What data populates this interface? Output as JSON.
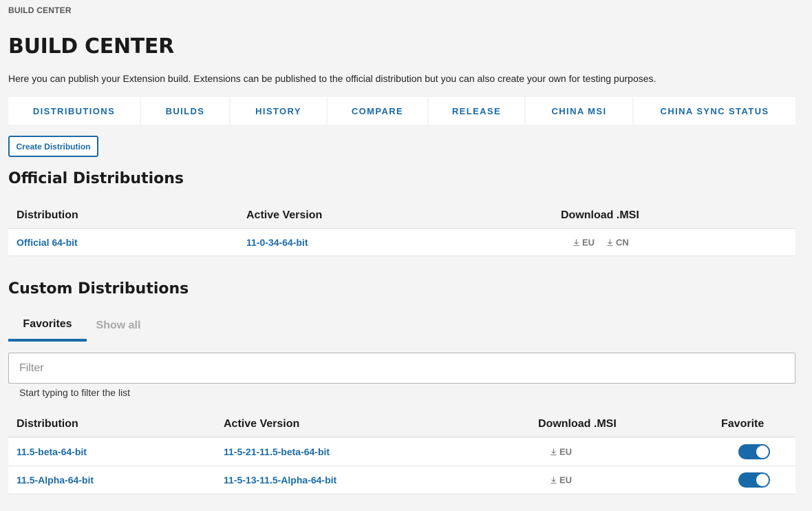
{
  "breadcrumb": "BUILD CENTER",
  "page_title": "BUILD CENTER",
  "intro": "Here you can publish your Extension build. Extensions can be published to the official distribution but you can also create your own for testing purposes.",
  "nav_tabs": [
    "DISTRIBUTIONS",
    "BUILDS",
    "HISTORY",
    "COMPARE",
    "RELEASE",
    "CHINA MSI",
    "CHINA SYNC STATUS"
  ],
  "create_button": "Create Distribution",
  "official": {
    "title": "Official Distributions",
    "headers": {
      "distribution": "Distribution",
      "active_version": "Active Version",
      "download": "Download .MSI"
    },
    "rows": [
      {
        "distribution": "Official 64-bit",
        "version": "11-0-34-64-bit",
        "downloads": [
          "EU",
          "CN"
        ]
      }
    ]
  },
  "custom": {
    "title": "Custom Distributions",
    "tabs": {
      "favorites": "Favorites",
      "show_all": "Show all"
    },
    "filter_placeholder": "Filter",
    "filter_value": "",
    "helper": "Start typing to filter the list",
    "headers": {
      "distribution": "Distribution",
      "active_version": "Active Version",
      "download": "Download .MSI",
      "favorite": "Favorite"
    },
    "rows": [
      {
        "distribution": "11.5-beta-64-bit",
        "version": "11-5-21-11.5-beta-64-bit",
        "download": "EU",
        "favorite": true
      },
      {
        "distribution": "11.5-Alpha-64-bit",
        "version": "11-5-13-11.5-Alpha-64-bit",
        "download": "EU",
        "favorite": true
      }
    ]
  },
  "colors": {
    "accent": "#1a6aa9",
    "background": "#f4f4f4"
  },
  "icons": {
    "download": "download-icon"
  }
}
